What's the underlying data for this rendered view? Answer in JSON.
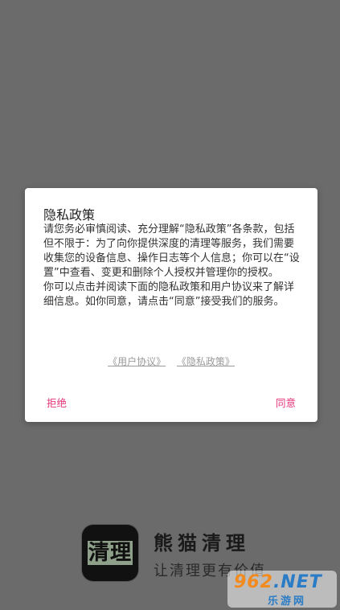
{
  "dialog": {
    "title": "隐私政策",
    "body": "请您务必审慎阅读、充分理解“隐私政策”各条款，包括但不限于：为了向你提供深度的清理等服务，我们需要收集您的设备信息、操作日志等个人信息；你可以在“设置”中查看、变更和删除个人授权并管理你的授权。\n你可以点击并阅读下面的隐私政策和用户协议来了解详细信息。如你同意，请点击“同意”接受我们的服务。",
    "link_user_agreement": "《用户协议》",
    "link_privacy_policy": "《隐私政策》",
    "reject_label": "拒绝",
    "agree_label": "同意"
  },
  "splash": {
    "logo_text": "清理",
    "app_name": "熊猫清理",
    "slogan": "让清理更有价值"
  },
  "watermark": {
    "top": "962",
    "top_suffix": ".NET",
    "bottom": "乐游网"
  },
  "colors": {
    "overlay": "#6b6b6b",
    "accent": "#e53478",
    "link": "#9a9a9a"
  }
}
